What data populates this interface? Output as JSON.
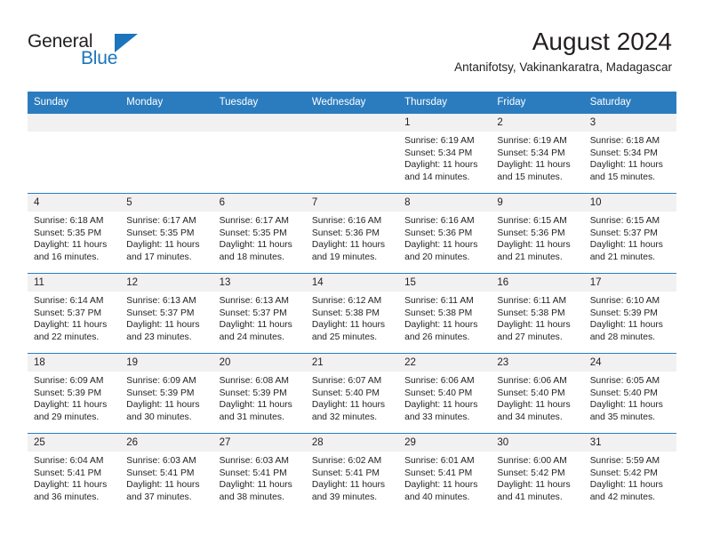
{
  "brand": {
    "name_part1": "General",
    "name_part2": "Blue",
    "accent_color": "#1c75bc",
    "logo_icon": "triangle-flag-icon"
  },
  "header": {
    "month_title": "August 2024",
    "location": "Antanifotsy, Vakinankaratra, Madagascar"
  },
  "calendar": {
    "header_color": "#2b7cbf",
    "daynum_bg": "#f1f1f1",
    "weekday_headers": [
      "Sunday",
      "Monday",
      "Tuesday",
      "Wednesday",
      "Thursday",
      "Friday",
      "Saturday"
    ],
    "weeks": [
      [
        {
          "day": "",
          "lines": []
        },
        {
          "day": "",
          "lines": []
        },
        {
          "day": "",
          "lines": []
        },
        {
          "day": "",
          "lines": []
        },
        {
          "day": "1",
          "lines": [
            "Sunrise: 6:19 AM",
            "Sunset: 5:34 PM",
            "Daylight: 11 hours",
            "and 14 minutes."
          ]
        },
        {
          "day": "2",
          "lines": [
            "Sunrise: 6:19 AM",
            "Sunset: 5:34 PM",
            "Daylight: 11 hours",
            "and 15 minutes."
          ]
        },
        {
          "day": "3",
          "lines": [
            "Sunrise: 6:18 AM",
            "Sunset: 5:34 PM",
            "Daylight: 11 hours",
            "and 15 minutes."
          ]
        }
      ],
      [
        {
          "day": "4",
          "lines": [
            "Sunrise: 6:18 AM",
            "Sunset: 5:35 PM",
            "Daylight: 11 hours",
            "and 16 minutes."
          ]
        },
        {
          "day": "5",
          "lines": [
            "Sunrise: 6:17 AM",
            "Sunset: 5:35 PM",
            "Daylight: 11 hours",
            "and 17 minutes."
          ]
        },
        {
          "day": "6",
          "lines": [
            "Sunrise: 6:17 AM",
            "Sunset: 5:35 PM",
            "Daylight: 11 hours",
            "and 18 minutes."
          ]
        },
        {
          "day": "7",
          "lines": [
            "Sunrise: 6:16 AM",
            "Sunset: 5:36 PM",
            "Daylight: 11 hours",
            "and 19 minutes."
          ]
        },
        {
          "day": "8",
          "lines": [
            "Sunrise: 6:16 AM",
            "Sunset: 5:36 PM",
            "Daylight: 11 hours",
            "and 20 minutes."
          ]
        },
        {
          "day": "9",
          "lines": [
            "Sunrise: 6:15 AM",
            "Sunset: 5:36 PM",
            "Daylight: 11 hours",
            "and 21 minutes."
          ]
        },
        {
          "day": "10",
          "lines": [
            "Sunrise: 6:15 AM",
            "Sunset: 5:37 PM",
            "Daylight: 11 hours",
            "and 21 minutes."
          ]
        }
      ],
      [
        {
          "day": "11",
          "lines": [
            "Sunrise: 6:14 AM",
            "Sunset: 5:37 PM",
            "Daylight: 11 hours",
            "and 22 minutes."
          ]
        },
        {
          "day": "12",
          "lines": [
            "Sunrise: 6:13 AM",
            "Sunset: 5:37 PM",
            "Daylight: 11 hours",
            "and 23 minutes."
          ]
        },
        {
          "day": "13",
          "lines": [
            "Sunrise: 6:13 AM",
            "Sunset: 5:37 PM",
            "Daylight: 11 hours",
            "and 24 minutes."
          ]
        },
        {
          "day": "14",
          "lines": [
            "Sunrise: 6:12 AM",
            "Sunset: 5:38 PM",
            "Daylight: 11 hours",
            "and 25 minutes."
          ]
        },
        {
          "day": "15",
          "lines": [
            "Sunrise: 6:11 AM",
            "Sunset: 5:38 PM",
            "Daylight: 11 hours",
            "and 26 minutes."
          ]
        },
        {
          "day": "16",
          "lines": [
            "Sunrise: 6:11 AM",
            "Sunset: 5:38 PM",
            "Daylight: 11 hours",
            "and 27 minutes."
          ]
        },
        {
          "day": "17",
          "lines": [
            "Sunrise: 6:10 AM",
            "Sunset: 5:39 PM",
            "Daylight: 11 hours",
            "and 28 minutes."
          ]
        }
      ],
      [
        {
          "day": "18",
          "lines": [
            "Sunrise: 6:09 AM",
            "Sunset: 5:39 PM",
            "Daylight: 11 hours",
            "and 29 minutes."
          ]
        },
        {
          "day": "19",
          "lines": [
            "Sunrise: 6:09 AM",
            "Sunset: 5:39 PM",
            "Daylight: 11 hours",
            "and 30 minutes."
          ]
        },
        {
          "day": "20",
          "lines": [
            "Sunrise: 6:08 AM",
            "Sunset: 5:39 PM",
            "Daylight: 11 hours",
            "and 31 minutes."
          ]
        },
        {
          "day": "21",
          "lines": [
            "Sunrise: 6:07 AM",
            "Sunset: 5:40 PM",
            "Daylight: 11 hours",
            "and 32 minutes."
          ]
        },
        {
          "day": "22",
          "lines": [
            "Sunrise: 6:06 AM",
            "Sunset: 5:40 PM",
            "Daylight: 11 hours",
            "and 33 minutes."
          ]
        },
        {
          "day": "23",
          "lines": [
            "Sunrise: 6:06 AM",
            "Sunset: 5:40 PM",
            "Daylight: 11 hours",
            "and 34 minutes."
          ]
        },
        {
          "day": "24",
          "lines": [
            "Sunrise: 6:05 AM",
            "Sunset: 5:40 PM",
            "Daylight: 11 hours",
            "and 35 minutes."
          ]
        }
      ],
      [
        {
          "day": "25",
          "lines": [
            "Sunrise: 6:04 AM",
            "Sunset: 5:41 PM",
            "Daylight: 11 hours",
            "and 36 minutes."
          ]
        },
        {
          "day": "26",
          "lines": [
            "Sunrise: 6:03 AM",
            "Sunset: 5:41 PM",
            "Daylight: 11 hours",
            "and 37 minutes."
          ]
        },
        {
          "day": "27",
          "lines": [
            "Sunrise: 6:03 AM",
            "Sunset: 5:41 PM",
            "Daylight: 11 hours",
            "and 38 minutes."
          ]
        },
        {
          "day": "28",
          "lines": [
            "Sunrise: 6:02 AM",
            "Sunset: 5:41 PM",
            "Daylight: 11 hours",
            "and 39 minutes."
          ]
        },
        {
          "day": "29",
          "lines": [
            "Sunrise: 6:01 AM",
            "Sunset: 5:41 PM",
            "Daylight: 11 hours",
            "and 40 minutes."
          ]
        },
        {
          "day": "30",
          "lines": [
            "Sunrise: 6:00 AM",
            "Sunset: 5:42 PM",
            "Daylight: 11 hours",
            "and 41 minutes."
          ]
        },
        {
          "day": "31",
          "lines": [
            "Sunrise: 5:59 AM",
            "Sunset: 5:42 PM",
            "Daylight: 11 hours",
            "and 42 minutes."
          ]
        }
      ]
    ]
  }
}
